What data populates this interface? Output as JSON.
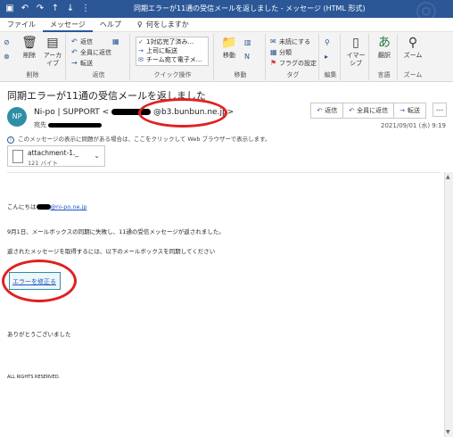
{
  "window": {
    "title": "同期エラーが11通の受信メールを返しました - メッセージ (HTML 形式)"
  },
  "menu": {
    "tabs": [
      "ファイル",
      "メッセージ",
      "ヘルプ"
    ],
    "tell_me": "何をしますか"
  },
  "ribbon": {
    "delete_group": {
      "label": "削除",
      "delete": "削除",
      "archive": "アーカイブ"
    },
    "respond_group": {
      "label": "返信",
      "reply": "返信",
      "reply_all": "全員に返信",
      "forward": "転送"
    },
    "quick_steps": {
      "label": "クイック操作",
      "items": [
        "1対応完了済み...",
        "上司に転送",
        "チーム宛て電子メ..."
      ]
    },
    "move_group": {
      "label": "移動",
      "move": "移動"
    },
    "tags_group": {
      "label": "タグ",
      "unread": "未読にする",
      "categorize": "分類",
      "follow_up": "フラグの設定"
    },
    "edit_group": {
      "label": "編集"
    },
    "immersive_group": {
      "label": "イマーシブ",
      "reader": "イマーシブ"
    },
    "language_group": {
      "label": "言語",
      "translate": "翻訳"
    },
    "zoom_group": {
      "label": "ズーム",
      "zoom": "ズーム"
    }
  },
  "message": {
    "subject": "同期エラーが11通の受信メールを返しました",
    "avatar_initials": "NP",
    "sender_name": "Ni-po | SUPPORT <",
    "sender_domain": "@b3.bunbun.ne.jp>",
    "to_label": "宛先",
    "date": "2021/09/01 (水) 9:19",
    "info_bar": "このメッセージの表示に問題がある場合は、ここをクリックして Web ブラウザーで表示します。",
    "actions": {
      "reply": "返信",
      "reply_all": "全員に返信",
      "forward": "転送",
      "more": "..."
    },
    "attachment": {
      "name": "attachment-1._",
      "size": "121 バイト"
    }
  },
  "body": {
    "greeting_prefix": "こんにちは",
    "greeting_email": "@ni-po.ne.jp",
    "paragraph1": "9月1日、メールボックスの同期に失敗し、11通の受信メッセージが返されました。",
    "paragraph2": "返されたメッセージを取得するには、以下のメールボックスを同期してください",
    "fix_button": "エラーを修正る",
    "thanks": "ありがとうございました",
    "rights": "ALL RIGHTS RESERVED."
  },
  "colors": {
    "titlebar": "#2b5797",
    "avatar": "#2e8ea6",
    "annotation": "#e02020",
    "link": "#1a57c8"
  }
}
